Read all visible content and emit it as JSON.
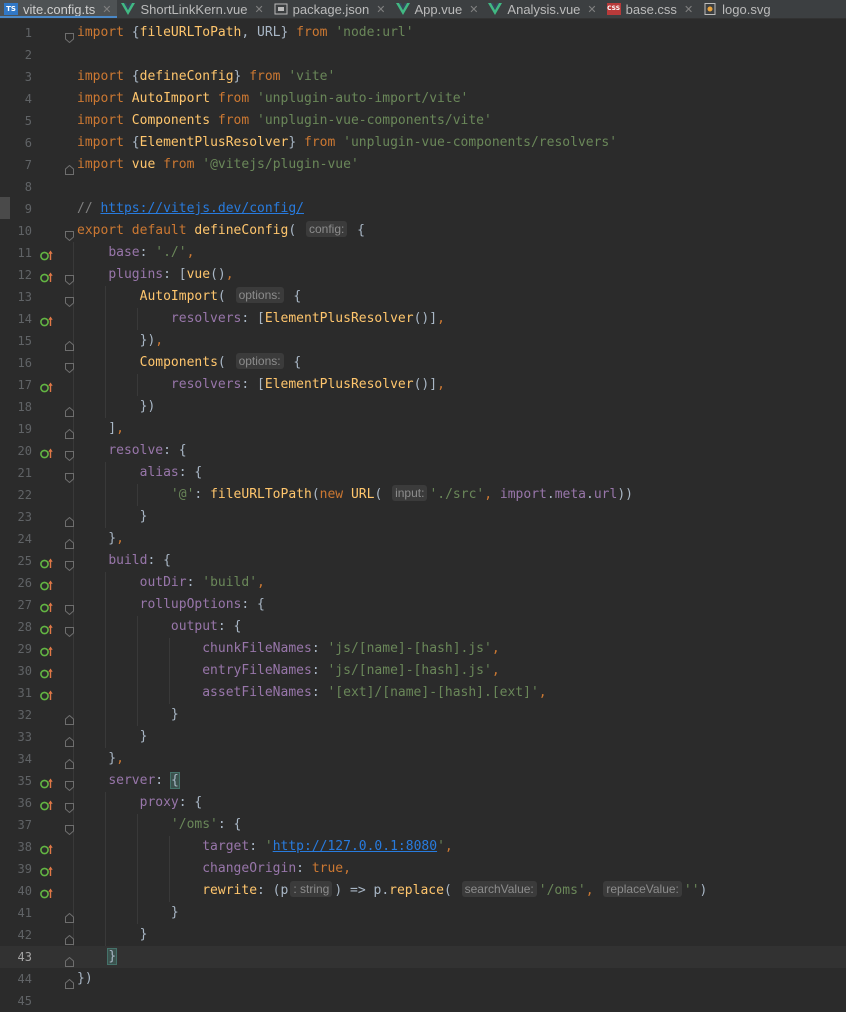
{
  "tabs": [
    {
      "label": "vite.config.ts",
      "icon": "typescript-file-icon",
      "badge": "TS",
      "active": true,
      "closable": true
    },
    {
      "label": "ShortLinkKern.vue",
      "icon": "vue-file-icon",
      "active": false,
      "closable": true
    },
    {
      "label": "package.json",
      "icon": "package-json-icon",
      "active": false,
      "closable": true
    },
    {
      "label": "App.vue",
      "icon": "vue-file-icon",
      "active": false,
      "closable": true
    },
    {
      "label": "Analysis.vue",
      "icon": "vue-file-icon",
      "active": false,
      "closable": true
    },
    {
      "label": "base.css",
      "icon": "css-file-icon",
      "badge": "CSS",
      "active": false,
      "closable": true
    },
    {
      "label": "logo.svg",
      "icon": "svg-file-icon",
      "active": false,
      "closable": false
    }
  ],
  "tab_close_glyph": "✕",
  "editor": {
    "current_line": 43,
    "lines": [
      {
        "n": 1,
        "fold": "open",
        "t": [
          [
            "kw",
            "import "
          ],
          [
            "p",
            "{"
          ],
          [
            "fn",
            "fileURLToPath"
          ],
          [
            "p",
            ", URL} "
          ],
          [
            "kw",
            "from "
          ],
          [
            "str",
            "'node:url'"
          ]
        ]
      },
      {
        "n": 2,
        "t": []
      },
      {
        "n": 3,
        "t": [
          [
            "kw",
            "import "
          ],
          [
            "p",
            "{"
          ],
          [
            "fn",
            "defineConfig"
          ],
          [
            "p",
            "} "
          ],
          [
            "kw",
            "from "
          ],
          [
            "str",
            "'vite'"
          ]
        ]
      },
      {
        "n": 4,
        "t": [
          [
            "kw",
            "import "
          ],
          [
            "fn",
            "AutoImport "
          ],
          [
            "kw",
            "from "
          ],
          [
            "str",
            "'unplugin-auto-import/vite'"
          ]
        ]
      },
      {
        "n": 5,
        "t": [
          [
            "kw",
            "import "
          ],
          [
            "fn",
            "Components "
          ],
          [
            "kw",
            "from "
          ],
          [
            "str",
            "'unplugin-vue-components/vite'"
          ]
        ]
      },
      {
        "n": 6,
        "t": [
          [
            "kw",
            "import "
          ],
          [
            "p",
            "{"
          ],
          [
            "fn",
            "ElementPlusResolver"
          ],
          [
            "p",
            "} "
          ],
          [
            "kw",
            "from "
          ],
          [
            "str",
            "'unplugin-vue-components/resolvers'"
          ]
        ]
      },
      {
        "n": 7,
        "fold": "close",
        "t": [
          [
            "kw",
            "import "
          ],
          [
            "fn",
            "vue "
          ],
          [
            "kw",
            "from "
          ],
          [
            "str",
            "'@vitejs/plugin-vue'"
          ]
        ]
      },
      {
        "n": 8,
        "t": []
      },
      {
        "n": 9,
        "t": [
          [
            "cm",
            "// "
          ],
          [
            "link",
            "https://vitejs.dev/config/"
          ]
        ]
      },
      {
        "n": 10,
        "fold": "open",
        "t": [
          [
            "kw",
            "export default "
          ],
          [
            "fn",
            "defineConfig"
          ],
          [
            "p",
            "( "
          ],
          [
            "hint",
            "config:"
          ],
          [
            "p",
            " {"
          ]
        ]
      },
      {
        "n": 11,
        "mark": true,
        "t": [
          [
            "p",
            "    "
          ],
          [
            "prop",
            "base"
          ],
          [
            "p",
            ": "
          ],
          [
            "str",
            "'./'"
          ],
          [
            "kw",
            ","
          ]
        ]
      },
      {
        "n": 12,
        "mark": true,
        "fold": "open",
        "t": [
          [
            "p",
            "    "
          ],
          [
            "prop",
            "plugins"
          ],
          [
            "p",
            ": ["
          ],
          [
            "fn",
            "vue"
          ],
          [
            "p",
            "()"
          ],
          [
            "kw",
            ","
          ]
        ]
      },
      {
        "n": 13,
        "fold": "open",
        "t": [
          [
            "p",
            "        "
          ],
          [
            "fn",
            "AutoImport"
          ],
          [
            "p",
            "( "
          ],
          [
            "hint",
            "options:"
          ],
          [
            "p",
            " {"
          ]
        ]
      },
      {
        "n": 14,
        "mark": true,
        "t": [
          [
            "p",
            "            "
          ],
          [
            "prop",
            "resolvers"
          ],
          [
            "p",
            ": ["
          ],
          [
            "fn",
            "ElementPlusResolver"
          ],
          [
            "p",
            "()]"
          ],
          [
            "kw",
            ","
          ]
        ]
      },
      {
        "n": 15,
        "fold": "close",
        "t": [
          [
            "p",
            "        })"
          ],
          [
            "kw",
            ","
          ]
        ]
      },
      {
        "n": 16,
        "fold": "open",
        "t": [
          [
            "p",
            "        "
          ],
          [
            "fn",
            "Components"
          ],
          [
            "p",
            "( "
          ],
          [
            "hint",
            "options:"
          ],
          [
            "p",
            " {"
          ]
        ]
      },
      {
        "n": 17,
        "mark": true,
        "t": [
          [
            "p",
            "            "
          ],
          [
            "prop",
            "resolvers"
          ],
          [
            "p",
            ": ["
          ],
          [
            "fn",
            "ElementPlusResolver"
          ],
          [
            "p",
            "()]"
          ],
          [
            "kw",
            ","
          ]
        ]
      },
      {
        "n": 18,
        "fold": "close",
        "t": [
          [
            "p",
            "        })"
          ]
        ]
      },
      {
        "n": 19,
        "fold": "close",
        "t": [
          [
            "p",
            "    ]"
          ],
          [
            "kw",
            ","
          ]
        ]
      },
      {
        "n": 20,
        "mark": true,
        "fold": "open",
        "t": [
          [
            "p",
            "    "
          ],
          [
            "prop",
            "resolve"
          ],
          [
            "p",
            ": {"
          ]
        ]
      },
      {
        "n": 21,
        "fold": "open",
        "t": [
          [
            "p",
            "        "
          ],
          [
            "prop",
            "alias"
          ],
          [
            "p",
            ": {"
          ]
        ]
      },
      {
        "n": 22,
        "t": [
          [
            "p",
            "            "
          ],
          [
            "str",
            "'@'"
          ],
          [
            "p",
            ": "
          ],
          [
            "fn",
            "fileURLToPath"
          ],
          [
            "p",
            "("
          ],
          [
            "kw",
            "new "
          ],
          [
            "fn",
            "URL"
          ],
          [
            "p",
            "( "
          ],
          [
            "hint",
            "input:"
          ],
          [
            "str",
            "'./src'"
          ],
          [
            "kw",
            ", "
          ],
          [
            "prop",
            "import"
          ],
          [
            "p",
            "."
          ],
          [
            "prop",
            "meta"
          ],
          [
            "p",
            "."
          ],
          [
            "prop",
            "url"
          ],
          [
            "p",
            "))"
          ]
        ]
      },
      {
        "n": 23,
        "fold": "close",
        "t": [
          [
            "p",
            "        }"
          ]
        ]
      },
      {
        "n": 24,
        "fold": "close",
        "t": [
          [
            "p",
            "    }"
          ],
          [
            "kw",
            ","
          ]
        ]
      },
      {
        "n": 25,
        "mark": true,
        "fold": "open",
        "t": [
          [
            "p",
            "    "
          ],
          [
            "prop",
            "build"
          ],
          [
            "p",
            ": {"
          ]
        ]
      },
      {
        "n": 26,
        "mark": true,
        "t": [
          [
            "p",
            "        "
          ],
          [
            "prop",
            "outDir"
          ],
          [
            "p",
            ": "
          ],
          [
            "str",
            "'build'"
          ],
          [
            "kw",
            ","
          ]
        ]
      },
      {
        "n": 27,
        "mark": true,
        "fold": "open",
        "t": [
          [
            "p",
            "        "
          ],
          [
            "prop",
            "rollupOptions"
          ],
          [
            "p",
            ": {"
          ]
        ]
      },
      {
        "n": 28,
        "mark": true,
        "fold": "open",
        "t": [
          [
            "p",
            "            "
          ],
          [
            "prop",
            "output"
          ],
          [
            "p",
            ": {"
          ]
        ]
      },
      {
        "n": 29,
        "mark": true,
        "t": [
          [
            "p",
            "                "
          ],
          [
            "prop",
            "chunkFileNames"
          ],
          [
            "p",
            ": "
          ],
          [
            "str",
            "'js/[name]-[hash].js'"
          ],
          [
            "kw",
            ","
          ]
        ]
      },
      {
        "n": 30,
        "mark": true,
        "t": [
          [
            "p",
            "                "
          ],
          [
            "prop",
            "entryFileNames"
          ],
          [
            "p",
            ": "
          ],
          [
            "str",
            "'js/[name]-[hash].js'"
          ],
          [
            "kw",
            ","
          ]
        ]
      },
      {
        "n": 31,
        "mark": true,
        "t": [
          [
            "p",
            "                "
          ],
          [
            "prop",
            "assetFileNames"
          ],
          [
            "p",
            ": "
          ],
          [
            "str",
            "'[ext]/[name]-[hash].[ext]'"
          ],
          [
            "kw",
            ","
          ]
        ]
      },
      {
        "n": 32,
        "fold": "close",
        "t": [
          [
            "p",
            "            }"
          ]
        ]
      },
      {
        "n": 33,
        "fold": "close",
        "t": [
          [
            "p",
            "        }"
          ]
        ]
      },
      {
        "n": 34,
        "fold": "close",
        "t": [
          [
            "p",
            "    }"
          ],
          [
            "kw",
            ","
          ]
        ]
      },
      {
        "n": 35,
        "mark": true,
        "fold": "open",
        "t": [
          [
            "p",
            "    "
          ],
          [
            "prop",
            "server"
          ],
          [
            "p",
            ": "
          ],
          [
            "bm",
            "{"
          ]
        ]
      },
      {
        "n": 36,
        "mark": true,
        "fold": "open",
        "t": [
          [
            "p",
            "        "
          ],
          [
            "prop",
            "proxy"
          ],
          [
            "p",
            ": {"
          ]
        ]
      },
      {
        "n": 37,
        "fold": "open",
        "t": [
          [
            "p",
            "            "
          ],
          [
            "str",
            "'/oms'"
          ],
          [
            "p",
            ": {"
          ]
        ]
      },
      {
        "n": 38,
        "mark": true,
        "t": [
          [
            "p",
            "                "
          ],
          [
            "prop",
            "target"
          ],
          [
            "p",
            ": "
          ],
          [
            "str",
            "'"
          ],
          [
            "link",
            "http://127.0.0.1:8080"
          ],
          [
            "str",
            "'"
          ],
          [
            "kw",
            ","
          ]
        ]
      },
      {
        "n": 39,
        "mark": true,
        "t": [
          [
            "p",
            "                "
          ],
          [
            "prop",
            "changeOrigin"
          ],
          [
            "p",
            ": "
          ],
          [
            "kw",
            "true,"
          ]
        ]
      },
      {
        "n": 40,
        "mark": true,
        "t": [
          [
            "p",
            "                "
          ],
          [
            "fn",
            "rewrite"
          ],
          [
            "p",
            ": (p"
          ],
          [
            "hint",
            ": string"
          ],
          [
            "p",
            ") => p."
          ],
          [
            "fn",
            "replace"
          ],
          [
            "p",
            "( "
          ],
          [
            "hint",
            "searchValue:"
          ],
          [
            "str",
            "'/oms'"
          ],
          [
            "kw",
            ", "
          ],
          [
            "hint",
            "replaceValue:"
          ],
          [
            "str",
            "''"
          ],
          [
            "p",
            ")"
          ]
        ]
      },
      {
        "n": 41,
        "fold": "close",
        "t": [
          [
            "p",
            "            }"
          ]
        ]
      },
      {
        "n": 42,
        "fold": "close",
        "t": [
          [
            "p",
            "        }"
          ]
        ]
      },
      {
        "n": 43,
        "fold": "close",
        "t": [
          [
            "p",
            "    "
          ],
          [
            "bm",
            "}"
          ]
        ]
      },
      {
        "n": 44,
        "fold": "close",
        "t": [
          [
            "p",
            "})"
          ]
        ]
      },
      {
        "n": 45,
        "t": []
      }
    ]
  }
}
